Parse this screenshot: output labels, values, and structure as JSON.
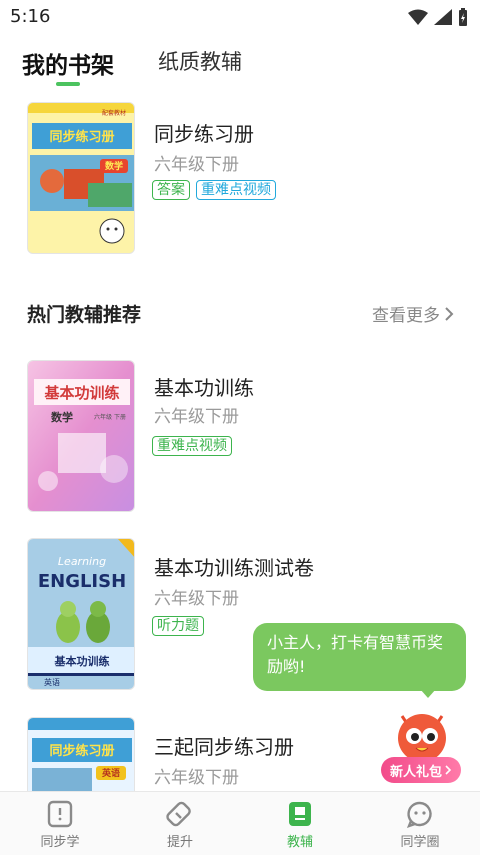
{
  "status": {
    "time": "5:16"
  },
  "top_tabs": {
    "active": "我的书架",
    "inactive": "纸质教辅"
  },
  "shelf": {
    "title": "同步练习册",
    "grade": "六年级下册",
    "tags": [
      "答案",
      "重难点视频"
    ],
    "cover_text": {
      "badge": "配套教材",
      "title": "同步练习册",
      "subject": "数学"
    }
  },
  "recommend": {
    "title": "热门教辅推荐",
    "more": "查看更多",
    "books": [
      {
        "title": "基本功训练",
        "grade": "六年级下册",
        "tags": [
          "重难点视频"
        ],
        "cover_text": {
          "title": "基本功训练",
          "subject": "数学",
          "edition": "六年级 下册"
        }
      },
      {
        "title": "基本功训练测试卷",
        "grade": "六年级下册",
        "tags": [
          "听力题"
        ],
        "cover_text": {
          "title": "ENGLISH",
          "script": "Learning",
          "bottom": "基本功训练",
          "subject": "英语"
        }
      },
      {
        "title": "三起同步练习册",
        "grade": "六年级下册",
        "tags": [],
        "cover_text": {
          "title": "同步练习册",
          "subject": "英语"
        }
      }
    ]
  },
  "tooltip": "小主人，打卡有智慧币奖励哟!",
  "gift_label": "新人礼包",
  "nav": {
    "items": [
      "同步学",
      "提升",
      "教辅",
      "同学圈"
    ],
    "active": "教辅"
  },
  "colors": {
    "accent_green": "#3db44d",
    "tag_blue": "#22a9dc",
    "tooltip_green": "#7bc85f",
    "gift_pink": "#f24b8a"
  }
}
